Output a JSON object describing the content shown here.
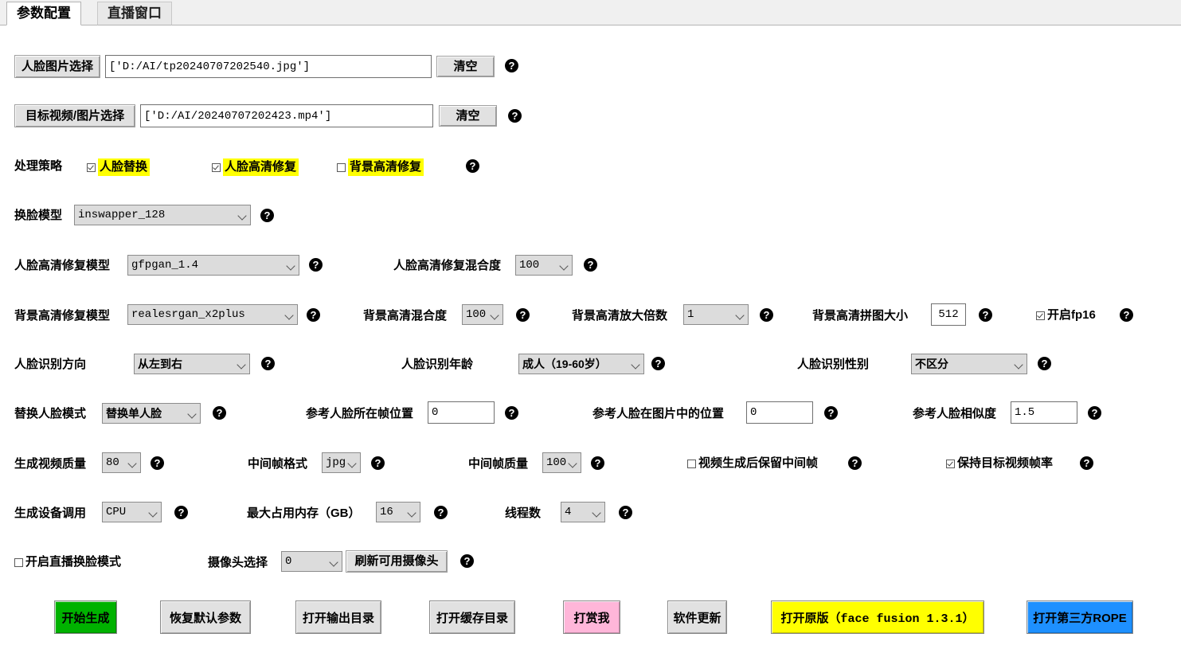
{
  "tabs": [
    {
      "label": "参数配置",
      "active": true
    },
    {
      "label": "直播窗口",
      "active": false
    }
  ],
  "help_glyph": "?",
  "rows": {
    "face_image": {
      "button_label": "人脸图片选择",
      "value": "['D:/AI/tp20240707202540.jpg']",
      "clear_label": "清空"
    },
    "target_media": {
      "button_label": "目标视频/图片选择",
      "value": "['D:/AI/20240707202423.mp4']",
      "clear_label": "清空"
    },
    "strategy": {
      "label": "处理策略",
      "options": [
        {
          "label": "人脸替换",
          "checked": true
        },
        {
          "label": "人脸高清修复",
          "checked": true
        },
        {
          "label": "背景高清修复",
          "checked": false
        }
      ]
    },
    "swap_model": {
      "label": "换脸模型",
      "value": "inswapper_128"
    },
    "face_restore_model": {
      "label": "人脸高清修复模型",
      "value": "gfpgan_1.4"
    },
    "face_restore_blend": {
      "label": "人脸高清修复混合度",
      "value": "100"
    },
    "bg_restore_model": {
      "label": "背景高清修复模型",
      "value": "realesrgan_x2plus"
    },
    "bg_blend": {
      "label": "背景高清混合度",
      "value": "100"
    },
    "bg_scale": {
      "label": "背景高清放大倍数",
      "value": "1"
    },
    "bg_tile": {
      "label": "背景高清拼图大小",
      "value": "512"
    },
    "fp16": {
      "label": "开启fp16",
      "checked": true
    },
    "detect_direction": {
      "label": "人脸识别方向",
      "value": "从左到右"
    },
    "detect_age": {
      "label": "人脸识别年龄",
      "value": "成人（19-60岁）"
    },
    "detect_gender": {
      "label": "人脸识别性别",
      "value": "不区分"
    },
    "swap_mode": {
      "label": "替换人脸模式",
      "value": "替换单人脸"
    },
    "ref_frame_pos": {
      "label": "参考人脸所在帧位置",
      "value": "0"
    },
    "ref_img_pos": {
      "label": "参考人脸在图片中的位置",
      "value": "0"
    },
    "ref_similarity": {
      "label": "参考人脸相似度",
      "value": "1.5"
    },
    "video_quality": {
      "label": "生成视频质量",
      "value": "80"
    },
    "frame_format": {
      "label": "中间帧格式",
      "value": "jpg"
    },
    "frame_quality": {
      "label": "中间帧质量",
      "value": "100"
    },
    "keep_frames": {
      "label": "视频生成后保留中间帧",
      "checked": false
    },
    "keep_fps": {
      "label": "保持目标视频帧率",
      "checked": true
    },
    "device": {
      "label": "生成设备调用",
      "value": "CPU"
    },
    "max_memory": {
      "label": "最大占用内存（GB）",
      "value": "16"
    },
    "threads": {
      "label": "线程数",
      "value": "4"
    },
    "live_mode": {
      "label": "开启直播换脸模式",
      "checked": false
    },
    "camera": {
      "label": "摄像头选择",
      "value": "0",
      "refresh_label": "刷新可用摄像头"
    }
  },
  "actions": [
    {
      "label": "开始生成",
      "color": "#00b200",
      "text_color": "#000000",
      "mono": false
    },
    {
      "label": "恢复默认参数",
      "color": "#e1e1e1",
      "text_color": "#000000",
      "mono": false
    },
    {
      "label": "打开输出目录",
      "color": "#e1e1e1",
      "text_color": "#000000",
      "mono": false
    },
    {
      "label": "打开缓存目录",
      "color": "#e1e1e1",
      "text_color": "#000000",
      "mono": false
    },
    {
      "label": "打赏我",
      "color": "#ffb6d9",
      "text_color": "#000000",
      "mono": false
    },
    {
      "label": "软件更新",
      "color": "#e1e1e1",
      "text_color": "#000000",
      "mono": false
    },
    {
      "label": "打开原版（face fusion 1.3.1）",
      "color": "#ffff00",
      "text_color": "#000000",
      "mono": true
    },
    {
      "label": "打开第三方ROPE",
      "color": "#1e90ff",
      "text_color": "#000000",
      "mono": false
    }
  ]
}
